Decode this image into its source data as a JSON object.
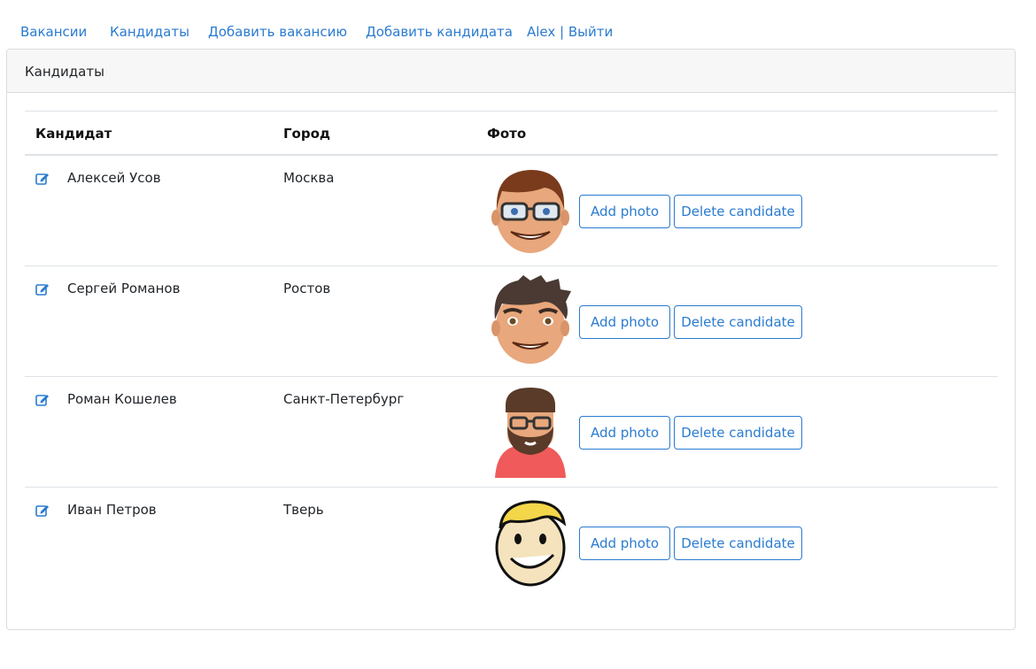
{
  "nav": {
    "links": [
      {
        "label": "Вакансии"
      },
      {
        "label": "Кандидаты"
      },
      {
        "label": "Добавить вакансию"
      },
      {
        "label": "Добавить кандидата"
      },
      {
        "label": "Alex | Выйти"
      }
    ]
  },
  "card": {
    "title": "Кандидаты"
  },
  "table": {
    "headers": {
      "candidate": "Кандидат",
      "city": "Город",
      "photo": "Фото"
    },
    "rows": [
      {
        "name": "Алексей Усов",
        "city": "Москва",
        "photo_icon": "avatar-glasses-man-icon"
      },
      {
        "name": "Сергей Романов",
        "city": "Ростов",
        "photo_icon": "avatar-spiky-hair-man-icon"
      },
      {
        "name": "Роман Кошелев",
        "city": "Санкт-Петербург",
        "photo_icon": "avatar-bearded-hoodie-man-icon"
      },
      {
        "name": "Иван Петров",
        "city": "Тверь",
        "photo_icon": "avatar-vault-boy-icon"
      }
    ],
    "add_photo_label": "Add photo",
    "delete_label": "Delete candidate"
  },
  "colors": {
    "link": "#2a7bd0",
    "header_bg": "#f7f7f7",
    "border": "#dee2e6"
  }
}
